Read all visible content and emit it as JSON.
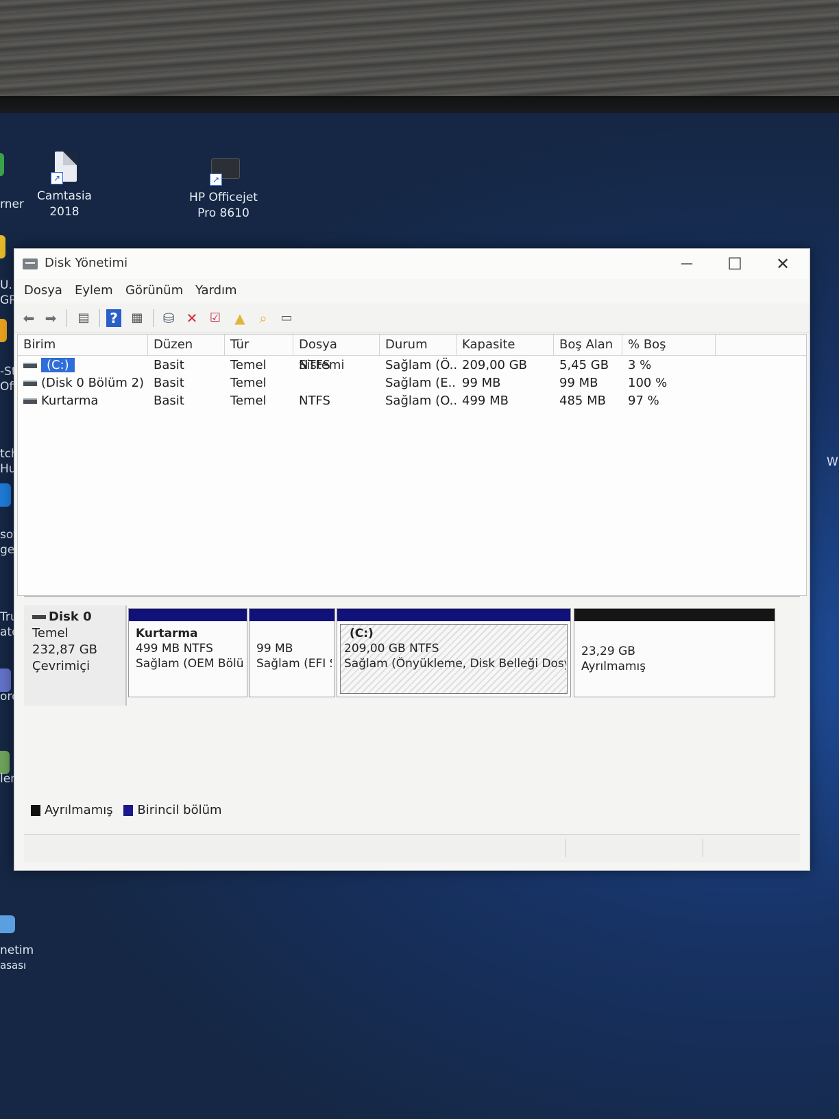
{
  "desktop": {
    "icons": [
      {
        "name": "Camtasia",
        "label_line1": "Camtasia",
        "label_line2": "2018"
      },
      {
        "name": "HP Officejet",
        "label_line1": "HP Officejet",
        "label_line2": "Pro 8610"
      }
    ],
    "edge_fragments": [
      "rner",
      "U.",
      "GR",
      "-St",
      "Offe",
      "tch",
      "Hur",
      "soft",
      "ge",
      "Truc",
      "ator",
      "ord",
      "lem",
      "netim",
      "asası"
    ],
    "right_fragment": "W"
  },
  "window": {
    "title": "Disk Yönetimi",
    "controls": {
      "minimize": "—",
      "maximize": "☐",
      "close": "✕"
    },
    "menu": [
      "Dosya",
      "Eylem",
      "Görünüm",
      "Yardım"
    ],
    "toolbar_icons": [
      "back-arrow-icon",
      "forward-arrow-icon",
      "show-hide-console-icon",
      "help-icon",
      "properties-pane-icon",
      "connect-drive-icon",
      "delete-icon",
      "checklist-icon",
      "folder-up-icon",
      "folder-search-icon",
      "properties-icon"
    ]
  },
  "volume_table": {
    "columns": [
      "Birim",
      "Düzen",
      "Tür",
      "Dosya Sistemi",
      "Durum",
      "Kapasite",
      "Boş Alan",
      "% Boş"
    ],
    "rows": [
      {
        "birim": "(C:)",
        "duzen": "Basit",
        "tur": "Temel",
        "dosya_sistemi": "NTFS",
        "durum": "Sağlam (Ö...",
        "kapasite": "209,00 GB",
        "bos_alan": "5,45 GB",
        "yuzde_bos": "3 %",
        "selected": true
      },
      {
        "birim": "(Disk 0 Bölüm 2)",
        "duzen": "Basit",
        "tur": "Temel",
        "dosya_sistemi": "",
        "durum": "Sağlam (E...",
        "kapasite": "99 MB",
        "bos_alan": "99 MB",
        "yuzde_bos": "100 %",
        "selected": false
      },
      {
        "birim": "Kurtarma",
        "duzen": "Basit",
        "tur": "Temel",
        "dosya_sistemi": "NTFS",
        "durum": "Sağlam (O...",
        "kapasite": "499 MB",
        "bos_alan": "485 MB",
        "yuzde_bos": "97 %",
        "selected": false
      }
    ]
  },
  "disk": {
    "name": "Disk 0",
    "type": "Temel",
    "size": "232,87 GB",
    "state": "Çevrimiçi",
    "partitions": [
      {
        "title": "Kurtarma",
        "line2": "499 MB NTFS",
        "line3": "Sağlam (OEM Bölür",
        "kind": "primary"
      },
      {
        "title": "",
        "line2": "99 MB",
        "line3": "Sağlam (EFI Si",
        "kind": "primary"
      },
      {
        "title": "(C:)",
        "line2": "209,00 GB NTFS",
        "line3": "Sağlam (Önyükleme, Disk Belleği Dosyası,",
        "kind": "primary-selected"
      },
      {
        "title": "",
        "line2": "23,29 GB",
        "line3": "Ayrılmamış",
        "kind": "unallocated"
      }
    ]
  },
  "legend": [
    {
      "label": "Ayrılmamış",
      "color": "#111111"
    },
    {
      "label": "Birincil bölüm",
      "color": "#1a1a8a"
    }
  ],
  "colors": {
    "primary_bar": "#10127a",
    "unallocated_bar": "#151515",
    "selection": "#2f6dd8"
  }
}
